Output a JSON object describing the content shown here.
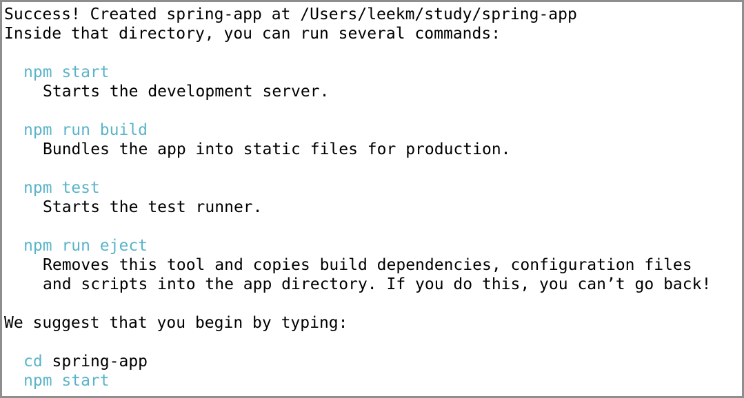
{
  "terminal": {
    "header_line1": "Success! Created spring-app at /Users/leekm/study/spring-app",
    "header_line2": "Inside that directory, you can run several commands:",
    "commands": [
      {
        "cmd": "npm start",
        "desc": [
          "Starts the development server."
        ]
      },
      {
        "cmd": "npm run build",
        "desc": [
          "Bundles the app into static files for production."
        ]
      },
      {
        "cmd": "npm test",
        "desc": [
          "Starts the test runner."
        ]
      },
      {
        "cmd": "npm run eject",
        "desc": [
          "Removes this tool and copies build dependencies, configuration files",
          "and scripts into the app directory. If you do this, you can’t go back!"
        ]
      }
    ],
    "suggest": "We suggest that you begin by typing:",
    "final_cd": "cd",
    "final_cd_arg": " spring-app",
    "final_start": "npm start"
  },
  "colors": {
    "command": "#5ab4c8",
    "text": "#000000",
    "border": "#8e8e8e"
  }
}
